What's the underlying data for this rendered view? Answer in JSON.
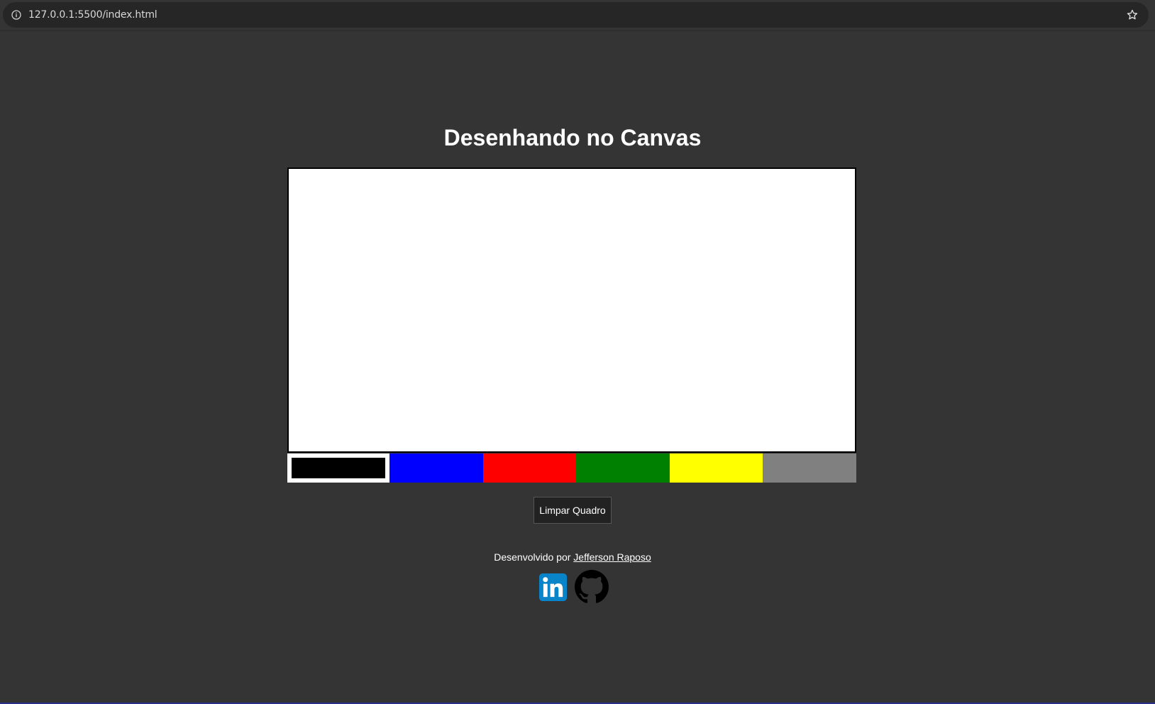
{
  "browser": {
    "url": "127.0.0.1:5500/index.html"
  },
  "page": {
    "title": "Desenhando no Canvas"
  },
  "palette": {
    "colors": [
      {
        "name": "black",
        "hex": "#000000",
        "selected": true
      },
      {
        "name": "blue",
        "hex": "#0000ff",
        "selected": false
      },
      {
        "name": "red",
        "hex": "#ff0000",
        "selected": false
      },
      {
        "name": "green",
        "hex": "#008000",
        "selected": false
      },
      {
        "name": "yellow",
        "hex": "#ffff00",
        "selected": false
      },
      {
        "name": "gray",
        "hex": "#808080",
        "selected": false
      }
    ]
  },
  "controls": {
    "clear_label": "Limpar Quadro"
  },
  "footer": {
    "credit_prefix": "Desenvolvido por ",
    "author_name": "Jefferson Raposo",
    "social": [
      {
        "name": "linkedin-icon",
        "color": "#0a84c8"
      },
      {
        "name": "github-icon",
        "color": "#000000"
      }
    ]
  },
  "theme": {
    "background": "#343434",
    "canvas_background": "#ffffff"
  }
}
